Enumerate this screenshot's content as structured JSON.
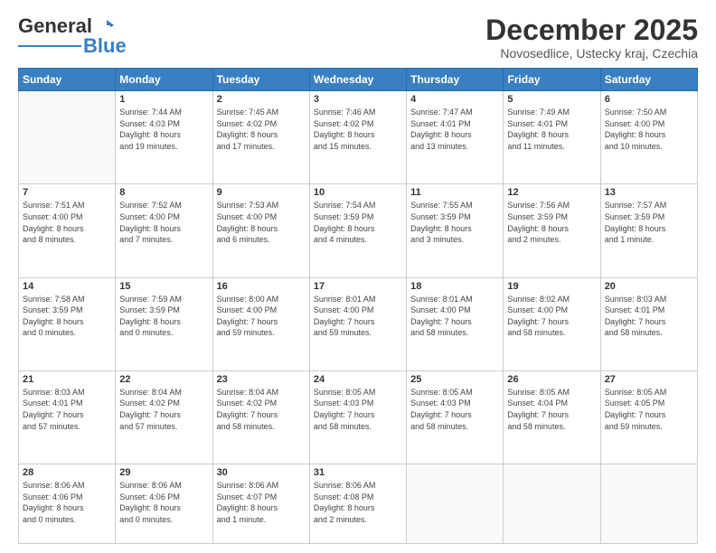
{
  "logo": {
    "text1": "General",
    "text2": "Blue"
  },
  "title": "December 2025",
  "subtitle": "Novosedlice, Ustecky kraj, Czechia",
  "weekdays": [
    "Sunday",
    "Monday",
    "Tuesday",
    "Wednesday",
    "Thursday",
    "Friday",
    "Saturday"
  ],
  "weeks": [
    [
      {
        "day": "",
        "info": ""
      },
      {
        "day": "1",
        "info": "Sunrise: 7:44 AM\nSunset: 4:03 PM\nDaylight: 8 hours\nand 19 minutes."
      },
      {
        "day": "2",
        "info": "Sunrise: 7:45 AM\nSunset: 4:02 PM\nDaylight: 8 hours\nand 17 minutes."
      },
      {
        "day": "3",
        "info": "Sunrise: 7:46 AM\nSunset: 4:02 PM\nDaylight: 8 hours\nand 15 minutes."
      },
      {
        "day": "4",
        "info": "Sunrise: 7:47 AM\nSunset: 4:01 PM\nDaylight: 8 hours\nand 13 minutes."
      },
      {
        "day": "5",
        "info": "Sunrise: 7:49 AM\nSunset: 4:01 PM\nDaylight: 8 hours\nand 11 minutes."
      },
      {
        "day": "6",
        "info": "Sunrise: 7:50 AM\nSunset: 4:00 PM\nDaylight: 8 hours\nand 10 minutes."
      }
    ],
    [
      {
        "day": "7",
        "info": "Sunrise: 7:51 AM\nSunset: 4:00 PM\nDaylight: 8 hours\nand 8 minutes."
      },
      {
        "day": "8",
        "info": "Sunrise: 7:52 AM\nSunset: 4:00 PM\nDaylight: 8 hours\nand 7 minutes."
      },
      {
        "day": "9",
        "info": "Sunrise: 7:53 AM\nSunset: 4:00 PM\nDaylight: 8 hours\nand 6 minutes."
      },
      {
        "day": "10",
        "info": "Sunrise: 7:54 AM\nSunset: 3:59 PM\nDaylight: 8 hours\nand 4 minutes."
      },
      {
        "day": "11",
        "info": "Sunrise: 7:55 AM\nSunset: 3:59 PM\nDaylight: 8 hours\nand 3 minutes."
      },
      {
        "day": "12",
        "info": "Sunrise: 7:56 AM\nSunset: 3:59 PM\nDaylight: 8 hours\nand 2 minutes."
      },
      {
        "day": "13",
        "info": "Sunrise: 7:57 AM\nSunset: 3:59 PM\nDaylight: 8 hours\nand 1 minute."
      }
    ],
    [
      {
        "day": "14",
        "info": "Sunrise: 7:58 AM\nSunset: 3:59 PM\nDaylight: 8 hours\nand 0 minutes."
      },
      {
        "day": "15",
        "info": "Sunrise: 7:59 AM\nSunset: 3:59 PM\nDaylight: 8 hours\nand 0 minutes."
      },
      {
        "day": "16",
        "info": "Sunrise: 8:00 AM\nSunset: 4:00 PM\nDaylight: 7 hours\nand 59 minutes."
      },
      {
        "day": "17",
        "info": "Sunrise: 8:01 AM\nSunset: 4:00 PM\nDaylight: 7 hours\nand 59 minutes."
      },
      {
        "day": "18",
        "info": "Sunrise: 8:01 AM\nSunset: 4:00 PM\nDaylight: 7 hours\nand 58 minutes."
      },
      {
        "day": "19",
        "info": "Sunrise: 8:02 AM\nSunset: 4:00 PM\nDaylight: 7 hours\nand 58 minutes."
      },
      {
        "day": "20",
        "info": "Sunrise: 8:03 AM\nSunset: 4:01 PM\nDaylight: 7 hours\nand 58 minutes."
      }
    ],
    [
      {
        "day": "21",
        "info": "Sunrise: 8:03 AM\nSunset: 4:01 PM\nDaylight: 7 hours\nand 57 minutes."
      },
      {
        "day": "22",
        "info": "Sunrise: 8:04 AM\nSunset: 4:02 PM\nDaylight: 7 hours\nand 57 minutes."
      },
      {
        "day": "23",
        "info": "Sunrise: 8:04 AM\nSunset: 4:02 PM\nDaylight: 7 hours\nand 58 minutes."
      },
      {
        "day": "24",
        "info": "Sunrise: 8:05 AM\nSunset: 4:03 PM\nDaylight: 7 hours\nand 58 minutes."
      },
      {
        "day": "25",
        "info": "Sunrise: 8:05 AM\nSunset: 4:03 PM\nDaylight: 7 hours\nand 58 minutes."
      },
      {
        "day": "26",
        "info": "Sunrise: 8:05 AM\nSunset: 4:04 PM\nDaylight: 7 hours\nand 58 minutes."
      },
      {
        "day": "27",
        "info": "Sunrise: 8:05 AM\nSunset: 4:05 PM\nDaylight: 7 hours\nand 59 minutes."
      }
    ],
    [
      {
        "day": "28",
        "info": "Sunrise: 8:06 AM\nSunset: 4:06 PM\nDaylight: 8 hours\nand 0 minutes."
      },
      {
        "day": "29",
        "info": "Sunrise: 8:06 AM\nSunset: 4:06 PM\nDaylight: 8 hours\nand 0 minutes."
      },
      {
        "day": "30",
        "info": "Sunrise: 8:06 AM\nSunset: 4:07 PM\nDaylight: 8 hours\nand 1 minute."
      },
      {
        "day": "31",
        "info": "Sunrise: 8:06 AM\nSunset: 4:08 PM\nDaylight: 8 hours\nand 2 minutes."
      },
      {
        "day": "",
        "info": ""
      },
      {
        "day": "",
        "info": ""
      },
      {
        "day": "",
        "info": ""
      }
    ]
  ]
}
